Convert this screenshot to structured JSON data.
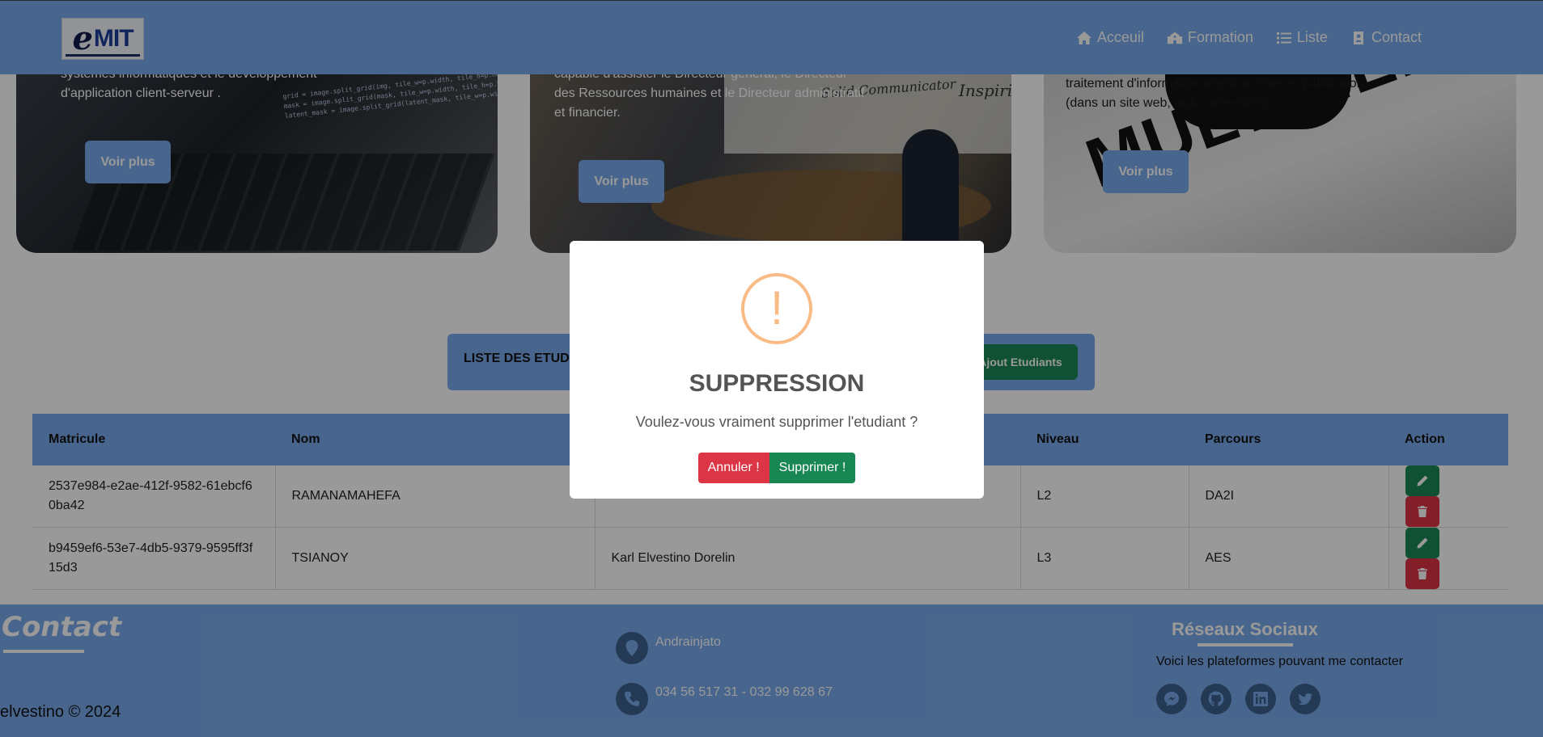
{
  "navbar": {
    "logo_e": "e",
    "logo_mit": "MIT",
    "items": [
      {
        "label": "Acceuil",
        "icon": "home-icon"
      },
      {
        "label": "Formation",
        "icon": "school-icon"
      },
      {
        "label": "Liste",
        "icon": "list-icon"
      },
      {
        "label": "Contact",
        "icon": "contact-card-icon"
      }
    ]
  },
  "cards": [
    {
      "text": "systèmes informatiques et le développement d'application client-serveur .",
      "button": "Voir plus"
    },
    {
      "text": "capable d'assister le Directeur général, le Directeur des Ressources humaines et le Directeur administratif et financier.",
      "button": "Voir plus",
      "board_text_1": "Solid Communicator",
      "board_text_2": "Inspirin"
    },
    {
      "text": "traitement d'information avant la mise en publication (dans un site web, radio, télévision).",
      "button": "Voir plus",
      "image_text": "MULTIMEDIA"
    }
  ],
  "list": {
    "title": "LISTE DES ETUDIANTS",
    "add_button": "Ajout Etudiants"
  },
  "table": {
    "headers": [
      "Matricule",
      "Nom",
      "",
      "Niveau",
      "Parcours",
      "Action"
    ],
    "rows": [
      {
        "matricule": "2537e984-e2ae-412f-9582-61ebcf60ba42",
        "nom": "RAMANAMAHEFA",
        "prenom": "",
        "niveau": "L2",
        "parcours": "DA2I"
      },
      {
        "matricule": "b9459ef6-53e7-4db5-9379-9595ff3f15d3",
        "nom": "TSIANOY",
        "prenom": "Karl Elvestino Dorelin",
        "niveau": "L3",
        "parcours": "AES"
      }
    ]
  },
  "footer": {
    "contact_title": "Contact",
    "copyright": "elvestino © 2024",
    "address": "Andrainjato",
    "phone": "034 56 517 31 - 032 99 628 67",
    "social_title": "Réseaux Sociaux",
    "social_sub": "Voici les plateformes pouvant me contacter",
    "socials": [
      "messenger-icon",
      "github-icon",
      "linkedin-icon",
      "twitter-icon"
    ]
  },
  "modal": {
    "icon": "!",
    "title": "SUPPRESSION",
    "text": "Voulez-vous vraiment supprimer l'etudiant ?",
    "cancel_label": "Annuler !",
    "confirm_label": "Supprimer !"
  },
  "colors": {
    "primary": "#79aaeb",
    "success": "#198754",
    "danger": "#dc3545",
    "warning": "#f8bb86"
  }
}
